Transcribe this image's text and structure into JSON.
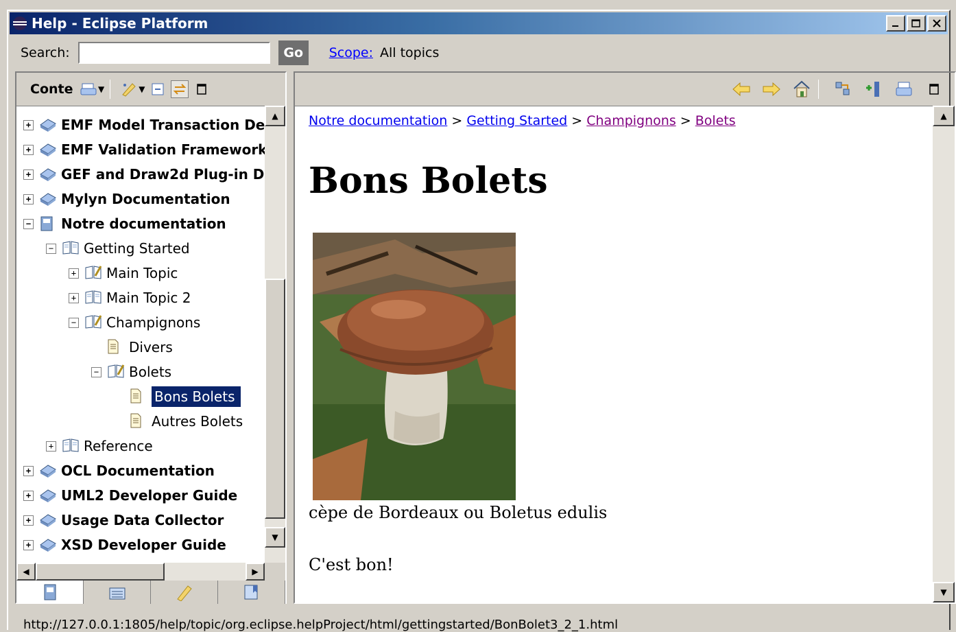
{
  "window": {
    "title": "Help - Eclipse Platform"
  },
  "search": {
    "label": "Search:",
    "value": "",
    "placeholder": "",
    "go_label": "Go",
    "scope_label": "Scope:",
    "scope_value": "All topics"
  },
  "left_pane": {
    "title": "Conte",
    "tree": [
      {
        "label": "EMF Model Transaction De",
        "level": 0,
        "expander": "+",
        "bold": true,
        "icon": "book-plugin-icon",
        "selected": false
      },
      {
        "label": "EMF Validation Framework",
        "level": 0,
        "expander": "+",
        "bold": true,
        "icon": "book-plugin-icon",
        "selected": false
      },
      {
        "label": "GEF and Draw2d Plug-in D",
        "level": 0,
        "expander": "+",
        "bold": true,
        "icon": "book-plugin-icon",
        "selected": false
      },
      {
        "label": "Mylyn Documentation",
        "level": 0,
        "expander": "+",
        "bold": true,
        "icon": "book-plugin-icon",
        "selected": false
      },
      {
        "label": "Notre documentation",
        "level": 0,
        "expander": "-",
        "bold": true,
        "icon": "book-closed-icon",
        "selected": false
      },
      {
        "label": "Getting Started",
        "level": 1,
        "expander": "-",
        "bold": false,
        "icon": "book-open-icon",
        "selected": false
      },
      {
        "label": "Main Topic",
        "level": 2,
        "expander": "+",
        "bold": false,
        "icon": "book-edit-icon",
        "selected": false
      },
      {
        "label": "Main Topic 2",
        "level": 2,
        "expander": "+",
        "bold": false,
        "icon": "book-open-icon",
        "selected": false
      },
      {
        "label": "Champignons",
        "level": 2,
        "expander": "-",
        "bold": false,
        "icon": "book-edit-icon",
        "selected": false
      },
      {
        "label": "Divers",
        "level": 3,
        "expander": "",
        "bold": false,
        "icon": "page-icon",
        "selected": false
      },
      {
        "label": "Bolets",
        "level": 3,
        "expander": "-",
        "bold": false,
        "icon": "book-edit-icon",
        "selected": false
      },
      {
        "label": "Bons Bolets",
        "level": 4,
        "expander": "",
        "bold": false,
        "icon": "page-icon",
        "selected": true
      },
      {
        "label": "Autres Bolets",
        "level": 4,
        "expander": "",
        "bold": false,
        "icon": "page-icon",
        "selected": false
      },
      {
        "label": "Reference",
        "level": 1,
        "expander": "+",
        "bold": false,
        "icon": "book-open-icon",
        "selected": false
      },
      {
        "label": "OCL Documentation",
        "level": 0,
        "expander": "+",
        "bold": true,
        "icon": "book-plugin-icon",
        "selected": false
      },
      {
        "label": "UML2 Developer Guide",
        "level": 0,
        "expander": "+",
        "bold": true,
        "icon": "book-plugin-icon",
        "selected": false
      },
      {
        "label": "Usage Data Collector",
        "level": 0,
        "expander": "+",
        "bold": true,
        "icon": "book-plugin-icon",
        "selected": false
      },
      {
        "label": "XSD Developer Guide",
        "level": 0,
        "expander": "+",
        "bold": true,
        "icon": "book-plugin-icon",
        "selected": false
      }
    ],
    "bottom_tabs": [
      "contents-tab-icon",
      "index-tab-icon",
      "search-results-tab-icon",
      "bookmarks-tab-icon"
    ]
  },
  "content": {
    "breadcrumb": [
      {
        "label": "Notre documentation",
        "visited": false
      },
      {
        "label": "Getting Started",
        "visited": false
      },
      {
        "label": "Champignons",
        "visited": true
      },
      {
        "label": "Bolets",
        "visited": true
      }
    ],
    "separator": ">",
    "heading": "Bons Bolets",
    "caption": "cèpe de Bordeaux ou Boletus edulis",
    "body": "C'est bon!"
  },
  "status": {
    "url": "http://127.0.0.1:1805/help/topic/org.eclipse.helpProject/html/gettingstarted/BonBolet3_2_1.html"
  },
  "colors": {
    "title_start": "#0a246a",
    "title_end": "#a6caf0",
    "selection": "#0a246a",
    "link": "#0000ee",
    "visited_link": "#800080"
  }
}
